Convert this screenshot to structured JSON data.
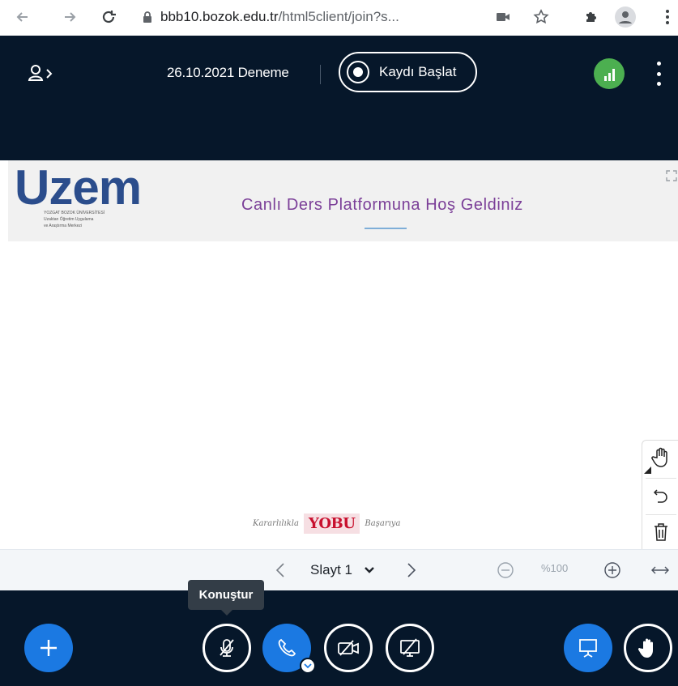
{
  "browser": {
    "url_main": "bbb10.bozok.edu.tr",
    "url_rest": "/html5client/join?s..."
  },
  "header": {
    "meeting_title": "26.10.2021 Deneme",
    "record_label": "Kaydı Başlat"
  },
  "slide": {
    "welcome_text": "Canlı Ders Platformuna Hoş Geldiniz",
    "logo_word": "Uzem",
    "logo_sub_1": "YOZGAT BOZOK ÜNİVERSİTESİ",
    "logo_sub_2": "Uzaktan Öğretim Uygulama",
    "logo_sub_3": "ve Araştırma Merkezi",
    "footer_left": "Kararlılıkla",
    "footer_brand": "YOBU",
    "footer_right": "Başarıya"
  },
  "slide_controls": {
    "slide_label": "Slayt 1",
    "zoom_value": "%100"
  },
  "bottom": {
    "tooltip": "Konuştur"
  },
  "colors": {
    "header_bg": "#06172a",
    "accent_blue": "#1b79e2",
    "connection_green": "#4caf50",
    "welcome_purple": "#7b3f98"
  }
}
